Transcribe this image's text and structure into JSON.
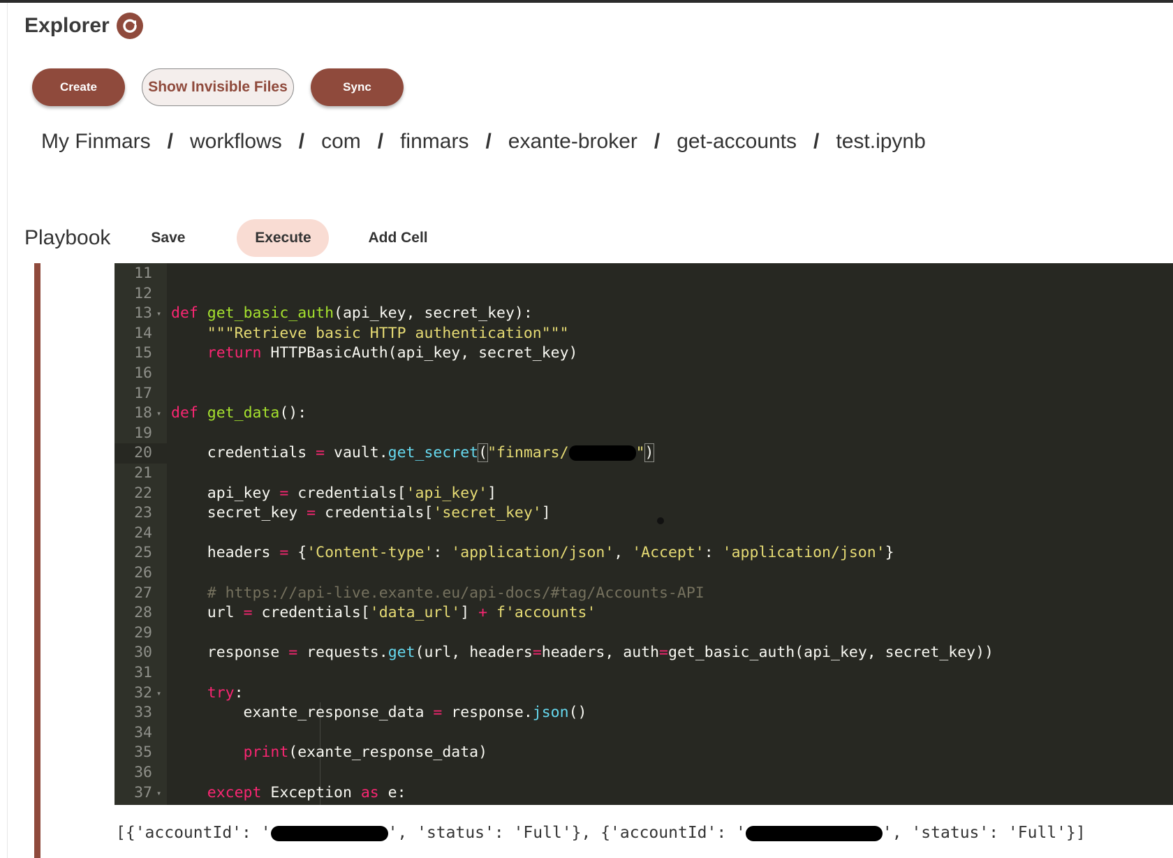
{
  "explorer": {
    "title": "Explorer",
    "refresh_icon": "refresh-icon"
  },
  "actions": {
    "create_label": "Create",
    "show_invisible_label": "Show Invisible Files",
    "sync_label": "Sync"
  },
  "breadcrumb": [
    "My Finmars",
    "workflows",
    "com",
    "finmars",
    "exante-broker",
    "get-accounts",
    "test.ipynb"
  ],
  "breadcrumb_separator": "/",
  "playbook": {
    "title": "Playbook",
    "save_label": "Save",
    "execute_label": "Execute",
    "add_cell_label": "Add Cell"
  },
  "editor": {
    "active_line": 20,
    "lines": [
      {
        "n": "11",
        "tokens": []
      },
      {
        "n": "12",
        "tokens": []
      },
      {
        "n": "13",
        "fold": true,
        "tokens": [
          [
            "k",
            "def"
          ],
          [
            "t",
            " "
          ],
          [
            "f",
            "get_basic_auth"
          ],
          [
            "t",
            "(api_key, secret_key):"
          ]
        ]
      },
      {
        "n": "14",
        "tokens": [
          [
            "t",
            "    "
          ],
          [
            "s",
            "\"\"\"Retrieve basic HTTP authentication\"\"\""
          ]
        ]
      },
      {
        "n": "15",
        "tokens": [
          [
            "t",
            "    "
          ],
          [
            "k",
            "return"
          ],
          [
            "t",
            " HTTPBasicAuth(api_key, secret_key)"
          ]
        ]
      },
      {
        "n": "16",
        "tokens": []
      },
      {
        "n": "17",
        "tokens": []
      },
      {
        "n": "18",
        "fold": true,
        "tokens": [
          [
            "k",
            "def"
          ],
          [
            "t",
            " "
          ],
          [
            "f",
            "get_data"
          ],
          [
            "t",
            "():"
          ]
        ]
      },
      {
        "n": "19",
        "tokens": []
      },
      {
        "n": "20",
        "tokens": [
          [
            "t",
            "    credentials "
          ],
          [
            "o",
            "="
          ],
          [
            "t",
            " vault."
          ],
          [
            "m",
            "get_secret"
          ],
          [
            "b",
            "("
          ],
          [
            "s",
            "\"finmars/"
          ],
          [
            "r",
            "redacted"
          ],
          [
            "s",
            "\""
          ],
          [
            "b",
            ")"
          ]
        ]
      },
      {
        "n": "21",
        "tokens": []
      },
      {
        "n": "22",
        "tokens": [
          [
            "t",
            "    api_key "
          ],
          [
            "o",
            "="
          ],
          [
            "t",
            " credentials["
          ],
          [
            "s",
            "'api_key'"
          ],
          [
            "t",
            "]"
          ]
        ]
      },
      {
        "n": "23",
        "tokens": [
          [
            "t",
            "    secret_key "
          ],
          [
            "o",
            "="
          ],
          [
            "t",
            " credentials["
          ],
          [
            "s",
            "'secret_key'"
          ],
          [
            "t",
            "]"
          ]
        ]
      },
      {
        "n": "24",
        "tokens": []
      },
      {
        "n": "25",
        "tokens": [
          [
            "t",
            "    headers "
          ],
          [
            "o",
            "="
          ],
          [
            "t",
            " {"
          ],
          [
            "s",
            "'Content-type'"
          ],
          [
            "t",
            ": "
          ],
          [
            "s",
            "'application/json'"
          ],
          [
            "t",
            ", "
          ],
          [
            "s",
            "'Accept'"
          ],
          [
            "t",
            ": "
          ],
          [
            "s",
            "'application/json'"
          ],
          [
            "t",
            "}"
          ]
        ]
      },
      {
        "n": "26",
        "tokens": []
      },
      {
        "n": "27",
        "tokens": [
          [
            "t",
            "    "
          ],
          [
            "c",
            "# https://api-live.exante.eu/api-docs/#tag/Accounts-API"
          ]
        ]
      },
      {
        "n": "28",
        "tokens": [
          [
            "t",
            "    url "
          ],
          [
            "o",
            "="
          ],
          [
            "t",
            " credentials["
          ],
          [
            "s",
            "'data_url'"
          ],
          [
            "t",
            "] "
          ],
          [
            "o",
            "+"
          ],
          [
            "t",
            " "
          ],
          [
            "s",
            "f'accounts'"
          ]
        ]
      },
      {
        "n": "29",
        "tokens": []
      },
      {
        "n": "30",
        "tokens": [
          [
            "t",
            "    response "
          ],
          [
            "o",
            "="
          ],
          [
            "t",
            " requests."
          ],
          [
            "m",
            "get"
          ],
          [
            "t",
            "(url, headers"
          ],
          [
            "o",
            "="
          ],
          [
            "t",
            "headers, auth"
          ],
          [
            "o",
            "="
          ],
          [
            "t",
            "get_basic_auth(api_key, secret_key))"
          ]
        ]
      },
      {
        "n": "31",
        "tokens": []
      },
      {
        "n": "32",
        "fold": true,
        "tokens": [
          [
            "t",
            "    "
          ],
          [
            "k",
            "try"
          ],
          [
            "t",
            ":"
          ]
        ]
      },
      {
        "n": "33",
        "tokens": [
          [
            "t",
            "        exante_response_data "
          ],
          [
            "o",
            "="
          ],
          [
            "t",
            " response."
          ],
          [
            "m",
            "json"
          ],
          [
            "t",
            "()"
          ]
        ]
      },
      {
        "n": "34",
        "tokens": []
      },
      {
        "n": "35",
        "tokens": [
          [
            "t",
            "        "
          ],
          [
            "k",
            "print"
          ],
          [
            "t",
            "(exante_response_data)"
          ]
        ]
      },
      {
        "n": "36",
        "tokens": []
      },
      {
        "n": "37",
        "fold": true,
        "tokens": [
          [
            "t",
            "    "
          ],
          [
            "k",
            "except"
          ],
          [
            "t",
            " Exception "
          ],
          [
            "k",
            "as"
          ],
          [
            "t",
            " e:"
          ]
        ]
      }
    ]
  },
  "output": {
    "parts": [
      [
        "t",
        "[{'accountId': '"
      ],
      [
        "r",
        "redacted"
      ],
      [
        "t",
        "', 'status': 'Full'}, {'accountId': '"
      ],
      [
        "r",
        "redacted"
      ],
      [
        "t",
        "', 'status': 'Full'}]"
      ]
    ]
  }
}
